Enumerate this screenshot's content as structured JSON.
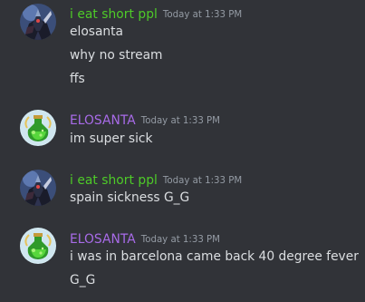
{
  "colors": {
    "background": "#313338",
    "message_text": "#dbdee1",
    "timestamp": "#949ba4",
    "user_green": "#4ecb28",
    "user_purple": "#a86be8"
  },
  "messages": [
    {
      "username": "i eat short ppl",
      "timestamp": "Today at 1:33 PM",
      "avatar_icon": "dark-armored-character-avatar",
      "lines": [
        "elosanta",
        "why no stream",
        "ffs"
      ]
    },
    {
      "username": "ELOSANTA",
      "timestamp": "Today at 1:33 PM",
      "avatar_icon": "green-potion-avatar",
      "lines": [
        "im super sick"
      ]
    },
    {
      "username": "i eat short ppl",
      "timestamp": "Today at 1:33 PM",
      "avatar_icon": "dark-armored-character-avatar",
      "lines": [
        "spain sickness G_G"
      ]
    },
    {
      "username": "ELOSANTA",
      "timestamp": "Today at 1:33 PM",
      "avatar_icon": "green-potion-avatar",
      "lines": [
        "i was in barcelona came back 40 degree fever",
        "G_G"
      ]
    }
  ]
}
